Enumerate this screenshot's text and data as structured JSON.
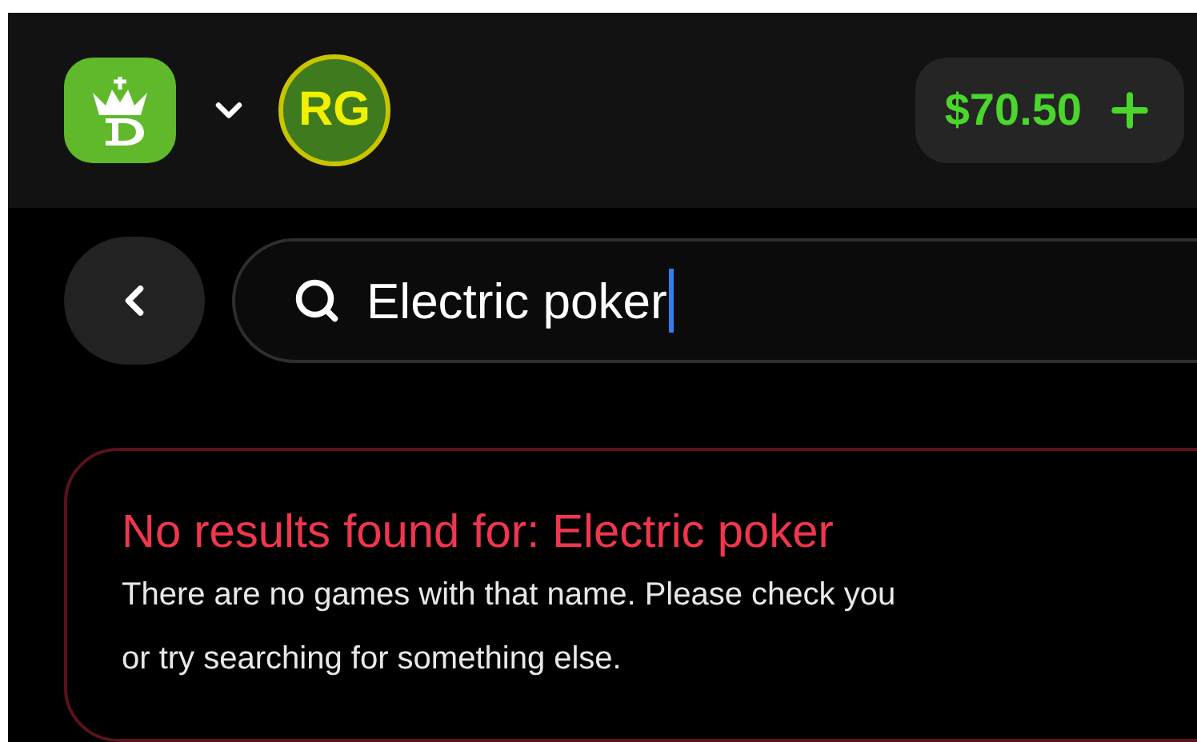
{
  "header": {
    "rg_badge": {
      "text": "RG"
    },
    "balance": "$70.50"
  },
  "search": {
    "value": "Electric poker",
    "focused": true
  },
  "no_results": {
    "title": "No results found for: Electric poker",
    "lines": [
      "There are no games with that name. Please check you",
      "or try searching for something else."
    ]
  }
}
